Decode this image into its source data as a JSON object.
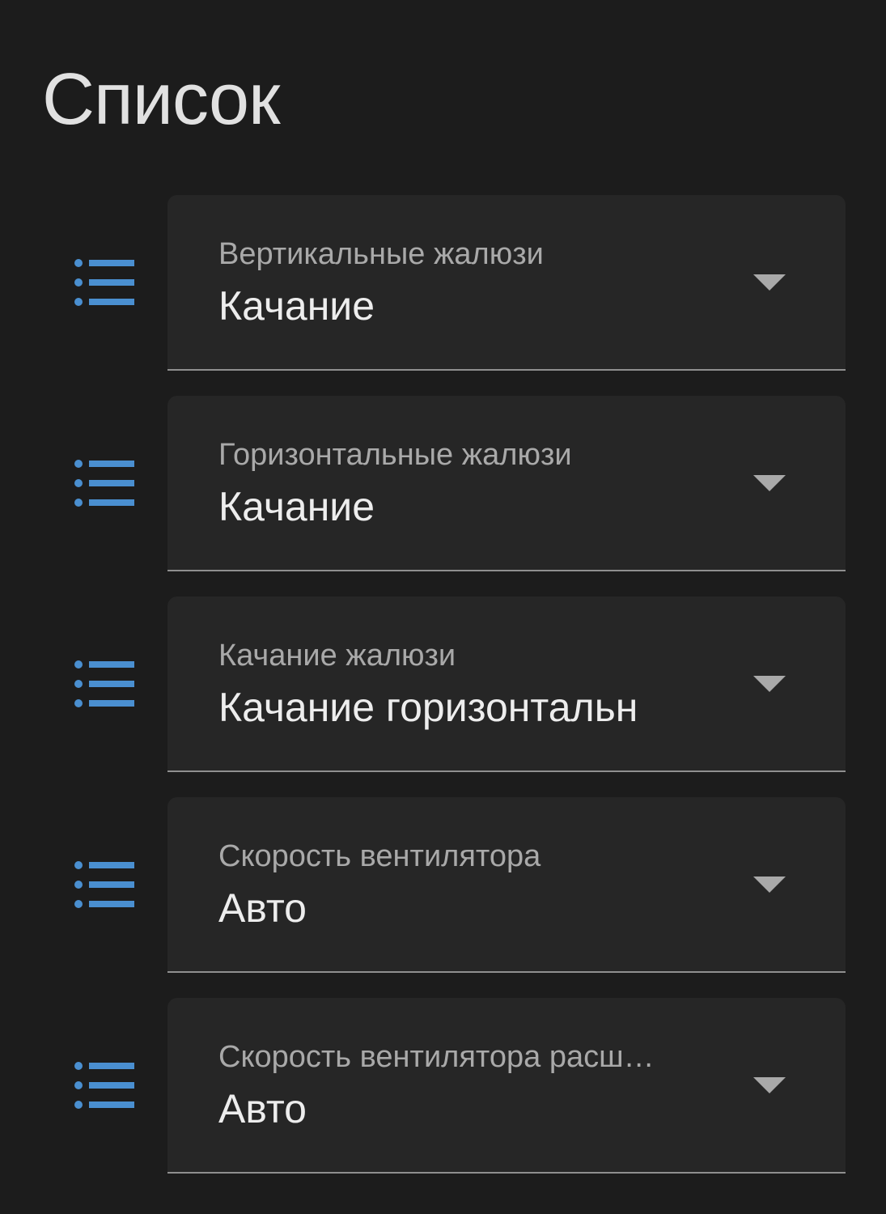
{
  "card": {
    "title": "Список"
  },
  "colors": {
    "background": "#1c1c1c",
    "field_background": "#262626",
    "icon_accent": "#4a8fd0",
    "label": "#a9a9a9",
    "value": "#ededed"
  },
  "rows": [
    {
      "icon": "format-list-bulleted-icon",
      "label": "Вертикальные жалюзи",
      "value": "Качание"
    },
    {
      "icon": "format-list-bulleted-icon",
      "label": "Горизонтальные жалюзи",
      "value": "Качание"
    },
    {
      "icon": "format-list-bulleted-icon",
      "label": "Качание жалюзи",
      "value": "Качание горизонтальн"
    },
    {
      "icon": "format-list-bulleted-icon",
      "label": "Скорость вентилятора",
      "value": "Авто"
    },
    {
      "icon": "format-list-bulleted-icon",
      "label": "Скорость вентилятора расш…",
      "value": "Авто"
    }
  ]
}
